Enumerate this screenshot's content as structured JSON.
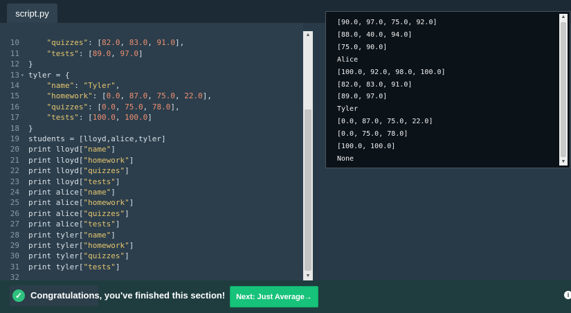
{
  "tab": {
    "label": "script.py"
  },
  "editor": {
    "lines": [
      {
        "no": "",
        "fold": "",
        "text": ""
      },
      {
        "no": "10",
        "fold": "",
        "text": "    \"quizzes\": [82.0, 83.0, 91.0],"
      },
      {
        "no": "11",
        "fold": "",
        "text": "    \"tests\": [89.0, 97.0]"
      },
      {
        "no": "12",
        "fold": "",
        "text": "}"
      },
      {
        "no": "13",
        "fold": "▾",
        "text": "tyler = {"
      },
      {
        "no": "14",
        "fold": "",
        "text": "    \"name\": \"Tyler\","
      },
      {
        "no": "15",
        "fold": "",
        "text": "    \"homework\": [0.0, 87.0, 75.0, 22.0],"
      },
      {
        "no": "16",
        "fold": "",
        "text": "    \"quizzes\": [0.0, 75.0, 78.0],"
      },
      {
        "no": "17",
        "fold": "",
        "text": "    \"tests\": [100.0, 100.0]"
      },
      {
        "no": "18",
        "fold": "",
        "text": "}"
      },
      {
        "no": "19",
        "fold": "",
        "text": "students = [lloyd,alice,tyler]"
      },
      {
        "no": "20",
        "fold": "",
        "text": "print lloyd[\"name\"]"
      },
      {
        "no": "21",
        "fold": "",
        "text": "print lloyd[\"homework\"]"
      },
      {
        "no": "22",
        "fold": "",
        "text": "print lloyd[\"quizzes\"]"
      },
      {
        "no": "23",
        "fold": "",
        "text": "print lloyd[\"tests\"]"
      },
      {
        "no": "24",
        "fold": "",
        "text": "print alice[\"name\"]"
      },
      {
        "no": "25",
        "fold": "",
        "text": "print alice[\"homework\"]"
      },
      {
        "no": "26",
        "fold": "",
        "text": "print alice[\"quizzes\"]"
      },
      {
        "no": "27",
        "fold": "",
        "text": "print alice[\"tests\"]"
      },
      {
        "no": "28",
        "fold": "",
        "text": "print tyler[\"name\"]"
      },
      {
        "no": "29",
        "fold": "",
        "text": "print tyler[\"homework\"]"
      },
      {
        "no": "30",
        "fold": "",
        "text": "print tyler[\"quizzes\"]"
      },
      {
        "no": "31",
        "fold": "",
        "text": "print tyler[\"tests\"]"
      },
      {
        "no": "32",
        "fold": "",
        "text": ""
      }
    ]
  },
  "console": {
    "lines": [
      "[90.0, 97.0, 75.0, 92.0]",
      "[88.0, 40.0, 94.0]",
      "[75.0, 90.0]",
      "Alice",
      "[100.0, 92.0, 98.0, 100.0]",
      "[82.0, 83.0, 91.0]",
      "[89.0, 97.0]",
      "Tyler",
      "[0.0, 87.0, 75.0, 22.0]",
      "[0.0, 75.0, 78.0]",
      "[100.0, 100.0]",
      "None"
    ]
  },
  "footer": {
    "message": "Congratulations, you've finished this section!",
    "next_label": "Next: Just Average→"
  },
  "icons": {
    "check": "check-circle-icon",
    "up": "arrow-up-icon",
    "down": "arrow-down-icon",
    "info": "info-icon"
  },
  "colors": {
    "accent_green": "#17c27a",
    "string_color": "#e4c56e",
    "number_color": "#ee8f70"
  }
}
